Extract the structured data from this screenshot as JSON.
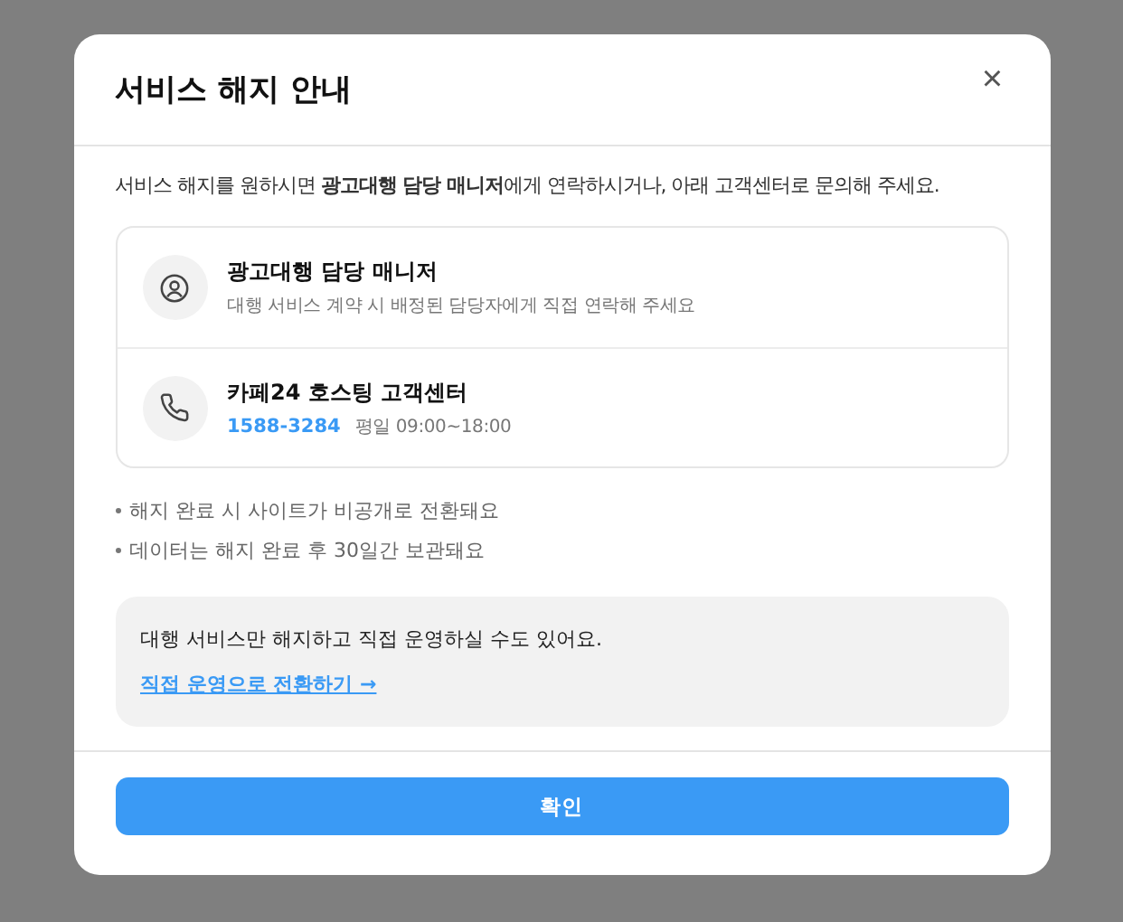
{
  "dialog": {
    "title": "서비스 해지 안내",
    "close_label": "×",
    "intro": "서비스 해지를 원하시면 **광고대행 담당 매니저**에게 연락하시거나, 아래 고객센터로 문의해 주세요.",
    "contacts": [
      {
        "kind": "manager",
        "name": "광고대행 담당 매니저",
        "description": "대행 서비스 계약 시 배정된 담당자에게 직접 연락해 주세요"
      },
      {
        "kind": "phone",
        "name": "카페24 호스팅 고객센터",
        "phone": "1588-3284",
        "hours": "평일 09:00~18:00"
      }
    ],
    "notes": [
      "해지 완료 시 사이트가 비공개로 전환돼요",
      "데이터는 해지 완료 후 30일간 보관돼요"
    ],
    "tip": {
      "text": "대행 서비스만 해지하고 직접 운영하실 수도 있어요.",
      "link": "직접 운영으로 전환하기 →"
    },
    "confirm_button": "확인"
  }
}
